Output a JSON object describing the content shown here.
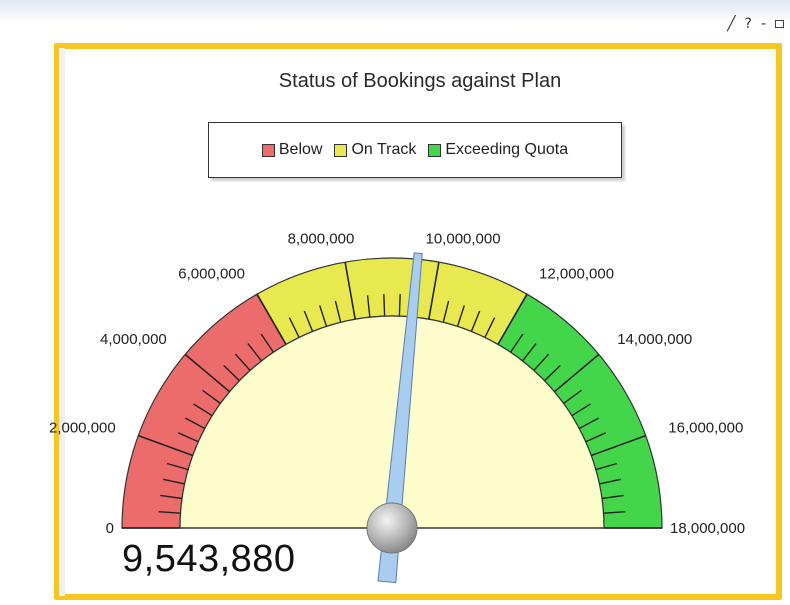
{
  "toolbar": {
    "edit_icon": "pencil-icon",
    "help_label": "?",
    "minimize_label": "-",
    "restore_icon": "restore-icon"
  },
  "chart_data": {
    "type": "gauge",
    "title": "Status of Bookings against Plan",
    "min": 0,
    "max": 18000000,
    "value": 9543880,
    "value_label": "9,543,880",
    "bands": [
      {
        "name": "Below",
        "from": 0,
        "to": 6000000,
        "color": "#ec6b6b"
      },
      {
        "name": "On Track",
        "from": 6000000,
        "to": 12000000,
        "color": "#e8e84f"
      },
      {
        "name": "Exceeding Quota",
        "from": 12000000,
        "to": 18000000,
        "color": "#44d64a"
      }
    ],
    "ticks": [
      {
        "value": 0,
        "label": "0"
      },
      {
        "value": 2000000,
        "label": "2,000,000"
      },
      {
        "value": 4000000,
        "label": "4,000,000"
      },
      {
        "value": 6000000,
        "label": "6,000,000"
      },
      {
        "value": 8000000,
        "label": "8,000,000"
      },
      {
        "value": 10000000,
        "label": "10,000,000"
      },
      {
        "value": 12000000,
        "label": "12,000,000"
      },
      {
        "value": 14000000,
        "label": "14,000,000"
      },
      {
        "value": 16000000,
        "label": "16,000,000"
      },
      {
        "value": 18000000,
        "label": "18,000,000"
      }
    ],
    "minor_per_major": 5,
    "legend": [
      "Below",
      "On Track",
      "Exceeding Quota"
    ],
    "legend_position": "top",
    "needle_color": "#a9cdf0",
    "face_color": "#fdfccb"
  }
}
